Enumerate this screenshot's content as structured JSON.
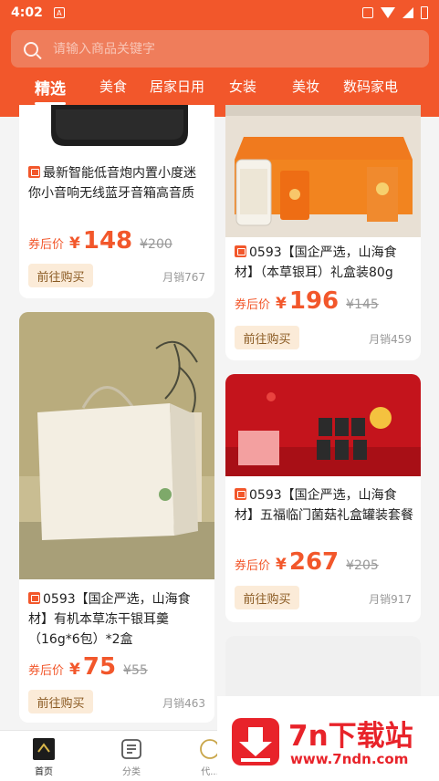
{
  "status_bar": {
    "time": "4:02"
  },
  "search": {
    "placeholder": "请输入商品关键字"
  },
  "tabs": [
    {
      "label": "精选",
      "active": true
    },
    {
      "label": "美食"
    },
    {
      "label": "居家日用"
    },
    {
      "label": "女装"
    },
    {
      "label": "美妆"
    },
    {
      "label": "数码家电"
    }
  ],
  "colors": {
    "brand": "#f2572b",
    "price": "#f2572b",
    "buy_bg": "#fbebd8",
    "buy_text": "#8a5a22"
  },
  "products": [
    {
      "title": "最新智能低音炮内置小度迷你小音响无线蓝牙音箱高音质",
      "price_label": "券后价",
      "currency": "¥",
      "price": "148",
      "original_price": "¥200",
      "buy_label": "前往购买",
      "sales": "月销767"
    },
    {
      "title": "0593【国企严选，山海食材】（本草银耳）礼盒装80g",
      "price_label": "券后价",
      "currency": "¥",
      "price": "196",
      "original_price": "¥145",
      "buy_label": "前往购买",
      "sales": "月销459"
    },
    {
      "title": "0593【国企严选，山海食材】有机本草冻干银耳羹（16g*6包）*2盒",
      "price_label": "券后价",
      "currency": "¥",
      "price": "75",
      "original_price": "¥55",
      "buy_label": "前往购买",
      "sales": "月销463"
    },
    {
      "title": "0593【国企严选，山海食材】五福临门菌菇礼盒罐装套餐",
      "price_label": "券后价",
      "currency": "¥",
      "price": "267",
      "original_price": "¥205",
      "buy_label": "前往购买",
      "sales": "月销917"
    }
  ],
  "bottom_nav": [
    {
      "label": "首页",
      "active": true
    },
    {
      "label": "分类"
    },
    {
      "label": "代..."
    }
  ],
  "watermark": {
    "text": "7n下载站",
    "url": "www.7ndn.com"
  }
}
